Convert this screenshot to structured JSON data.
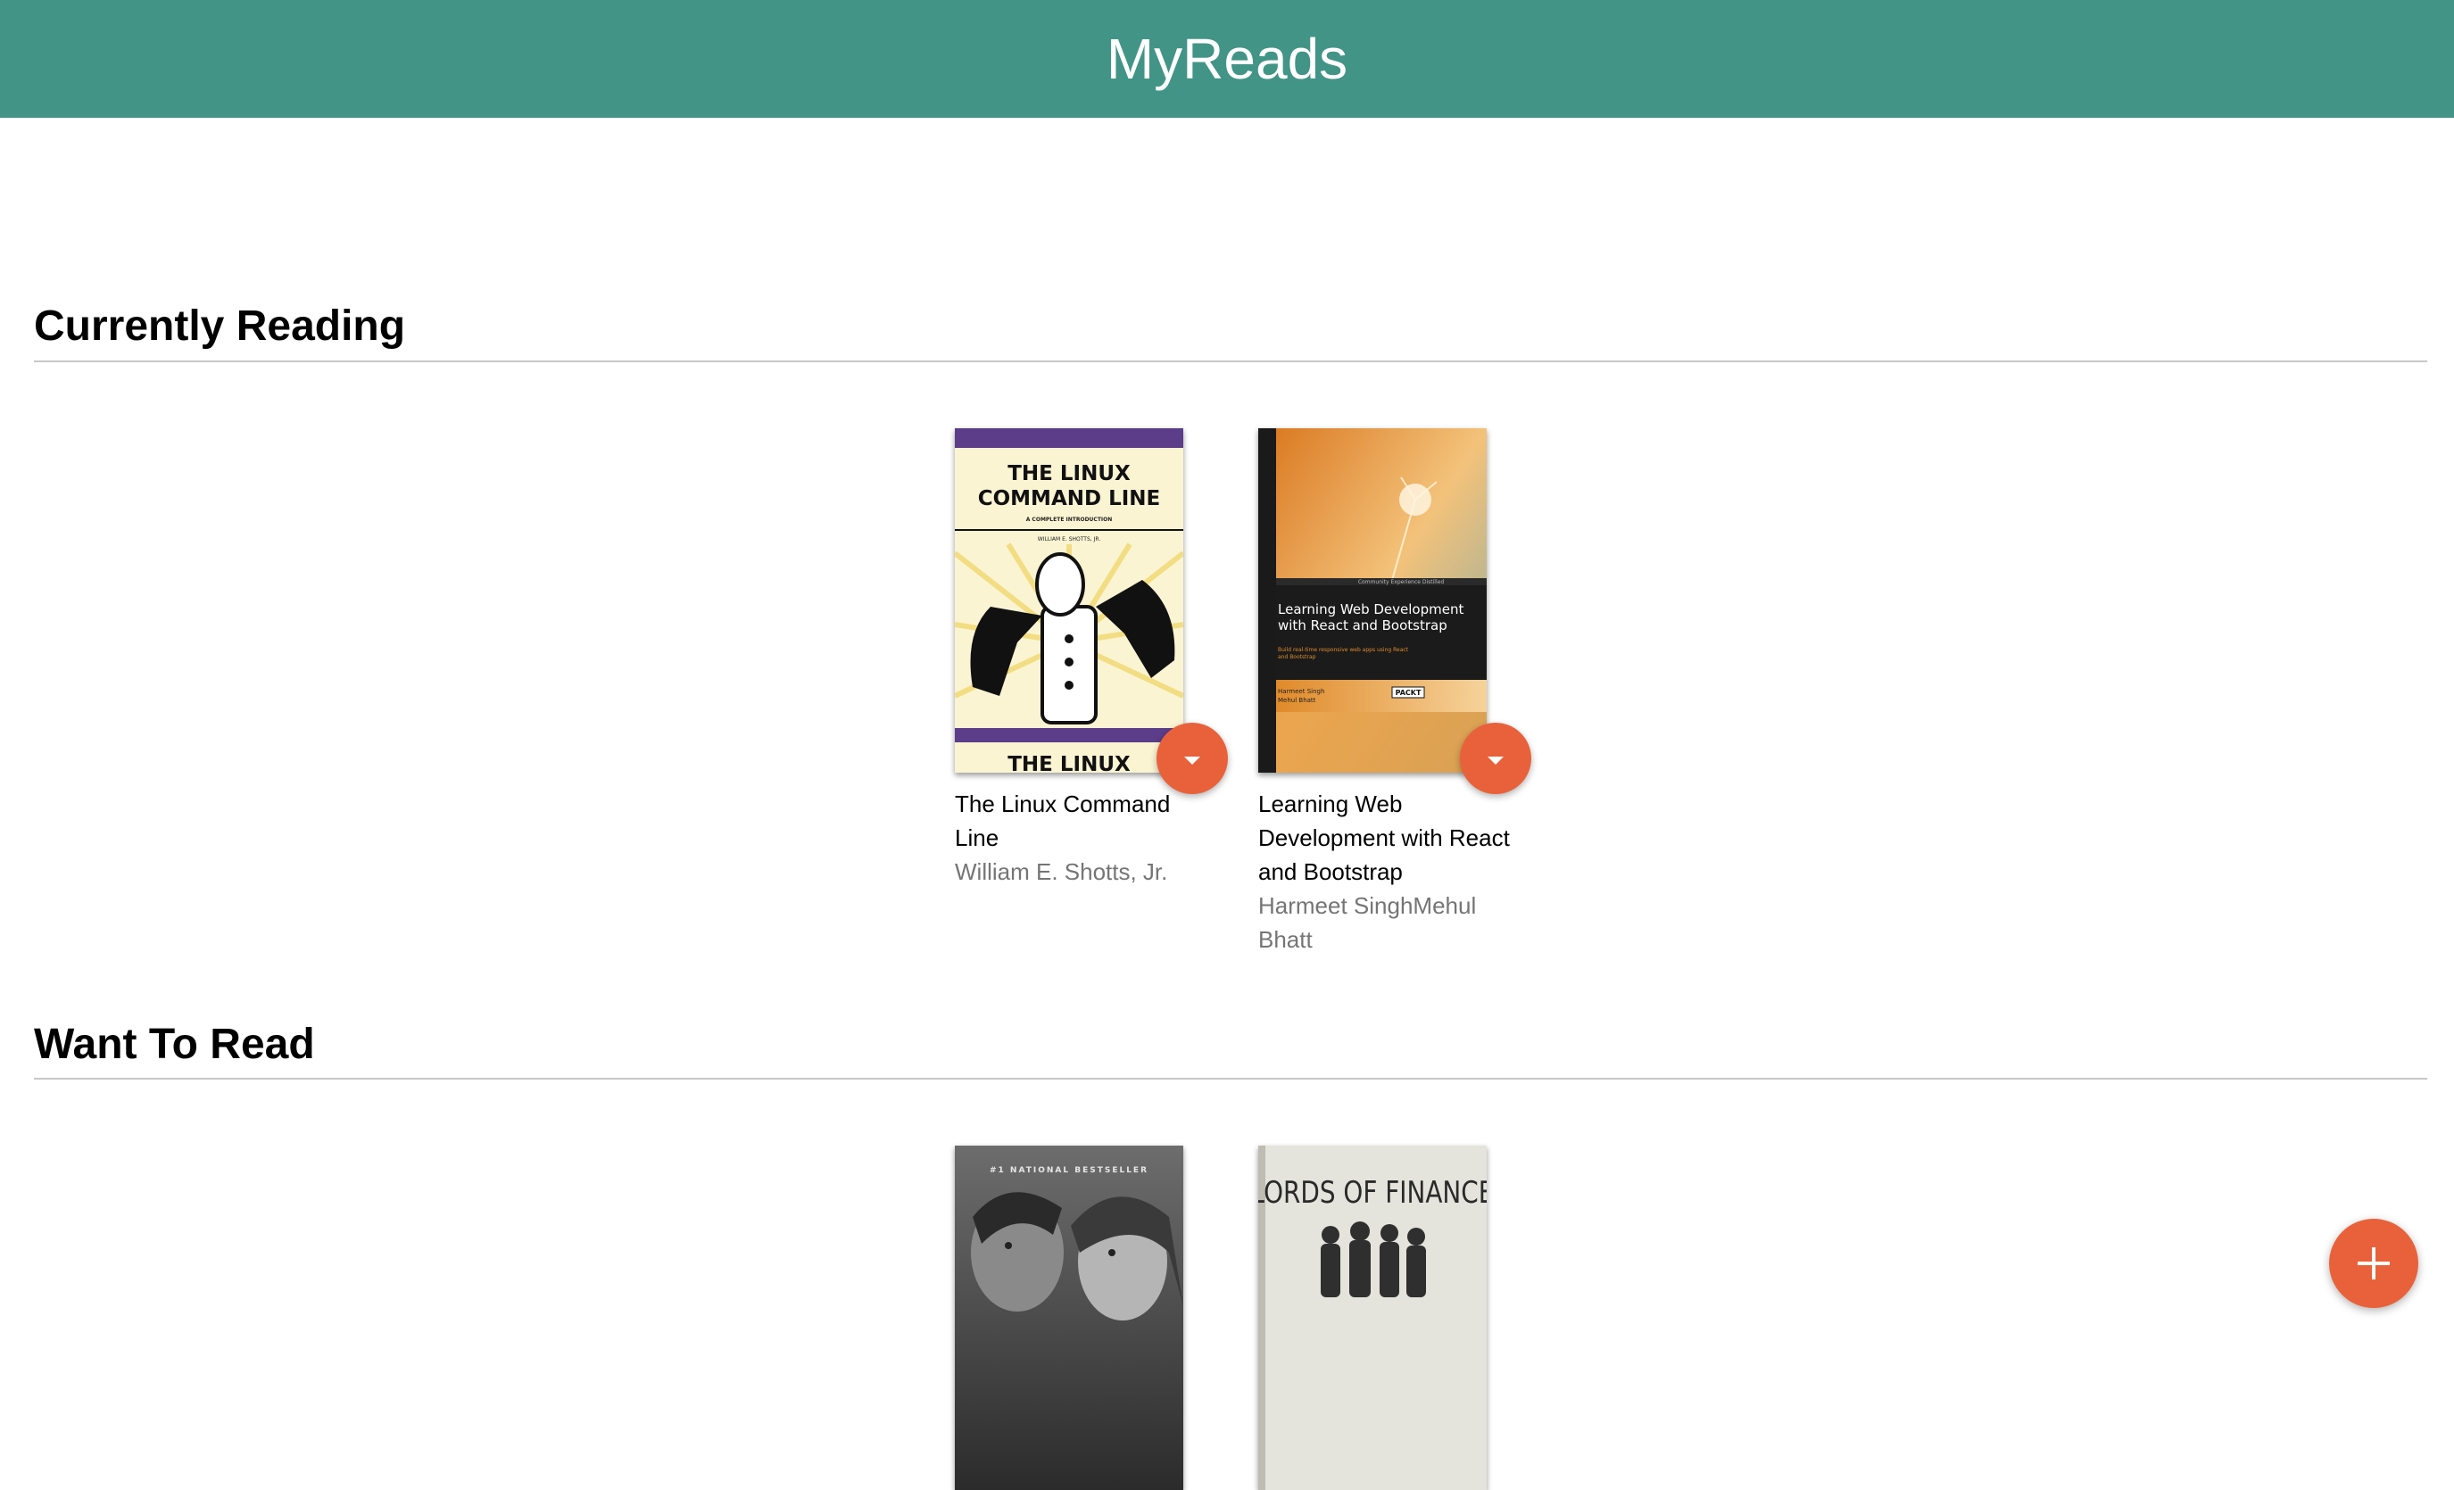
{
  "app": {
    "title": "MyReads"
  },
  "colors": {
    "header": "#429486",
    "accent": "#e9613a"
  },
  "shelves": [
    {
      "title": "Currently Reading",
      "books": [
        {
          "title": "The Linux Command Line",
          "authors": "William E. Shotts, Jr.",
          "cover": {
            "title_line1": "THE LINUX",
            "title_line2": "COMMAND LINE",
            "tagline": "A COMPLETE INTRODUCTION",
            "author": "WILLIAM E. SHOTTS, JR.",
            "footer": "THE LINUX"
          }
        },
        {
          "title": "Learning Web Development with React and Bootstrap",
          "authors": "Harmeet SinghMehul Bhatt",
          "cover": {
            "edition": "Community Experience Distilled",
            "title_line1": "Learning Web Development",
            "title_line2": "with React and Bootstrap",
            "subtitle_line1": "Build real-time responsive web apps using React",
            "subtitle_line2": "and Bootstrap",
            "author_line1": "Harmeet Singh",
            "author_line2": "Mehul Bhatt",
            "publisher": "PACKT"
          }
        }
      ]
    },
    {
      "title": "Want To Read",
      "books": [
        {
          "title": "",
          "authors": "",
          "cover": {
            "tagline": "#1 NATIONAL BESTSELLER"
          }
        },
        {
          "title": "",
          "authors": "",
          "cover": {
            "title_line1": "LORDS OF FINANCE"
          }
        }
      ]
    }
  ],
  "icons": {
    "shelf_changer": "caret-down-icon",
    "add": "plus-icon"
  }
}
